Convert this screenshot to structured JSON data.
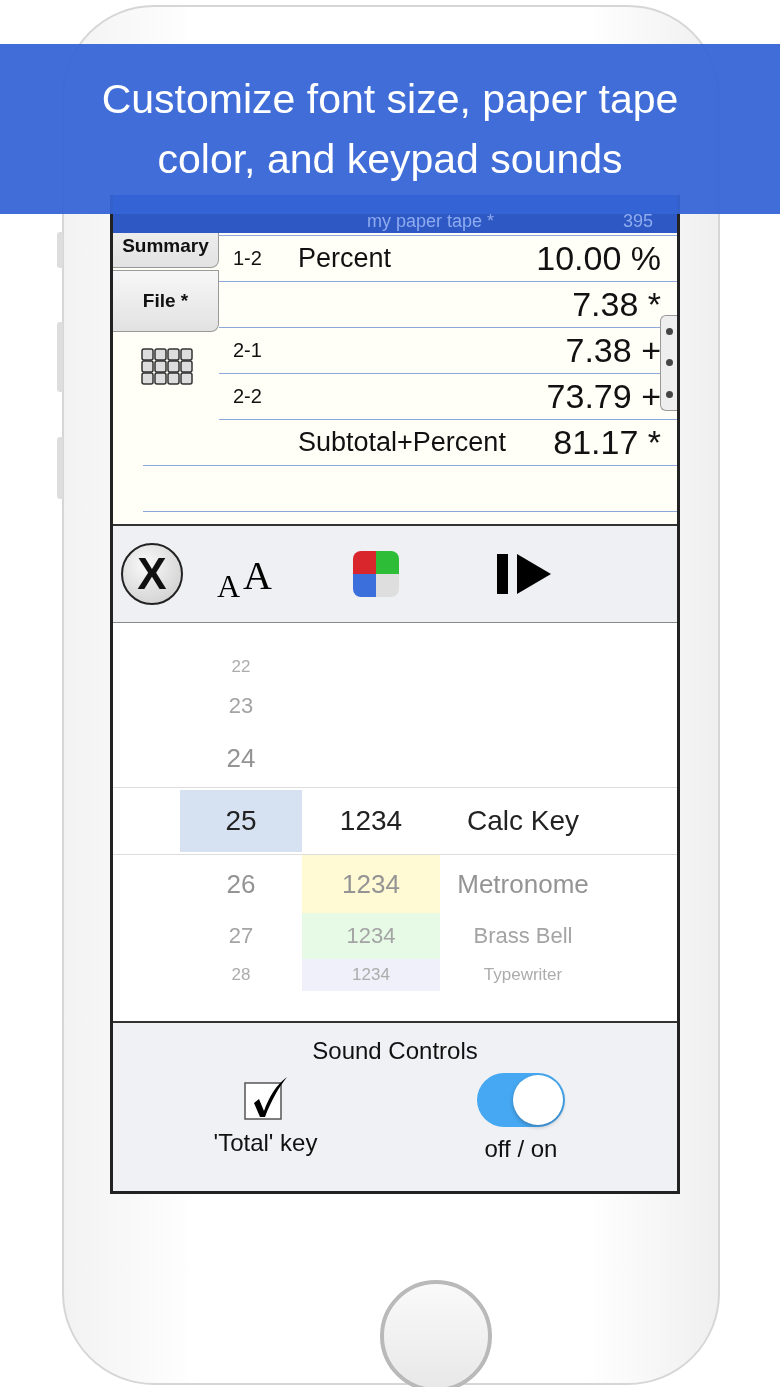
{
  "banner": {
    "text": "Customize font size, paper tape color, and keypad sounds"
  },
  "header": {
    "title": "my paper tape *",
    "count": "395"
  },
  "side_tabs": [
    {
      "label": "Summary"
    },
    {
      "label": "File *"
    }
  ],
  "tape": {
    "rows": [
      {
        "ref": "1-2",
        "label": "Percent",
        "value": "10.00 %"
      },
      {
        "ref": "",
        "label": "",
        "value": "7.38 *"
      },
      {
        "ref": "2-1",
        "label": "",
        "value": "7.38 +"
      },
      {
        "ref": "2-2",
        "label": "",
        "value": "73.79 +"
      },
      {
        "ref": "",
        "label": "Subtotal+Percent",
        "value": "81.17 *"
      },
      {
        "ref": "",
        "label": "",
        "value": ""
      }
    ]
  },
  "toolbar": [
    {
      "kind": "close",
      "glyph": "X"
    },
    {
      "kind": "font",
      "glyphs": [
        "A",
        "A"
      ]
    },
    {
      "kind": "color"
    },
    {
      "kind": "step"
    }
  ],
  "picker": [
    {
      "number": "22",
      "selected": false
    },
    {
      "number": "23",
      "selected": false
    },
    {
      "number": "24",
      "selected": false
    },
    {
      "number": "25",
      "sample": "1234",
      "name": "Calc Key",
      "selected": true
    },
    {
      "number": "26",
      "sample": "1234",
      "name": "Metronome",
      "color": "#fff9d4",
      "selected": false
    },
    {
      "number": "27",
      "sample": "1234",
      "name": "Brass Bell",
      "color": "#e6fae6",
      "selected": false
    },
    {
      "number": "28",
      "sample": "1234",
      "name": "Typewriter",
      "color": "#f0f0fa",
      "selected": false
    }
  ],
  "sound": {
    "title": "Sound Controls",
    "total_key": {
      "label": "'Total' key",
      "checked": true
    },
    "toggle": {
      "label": "off / on",
      "on": true
    }
  }
}
